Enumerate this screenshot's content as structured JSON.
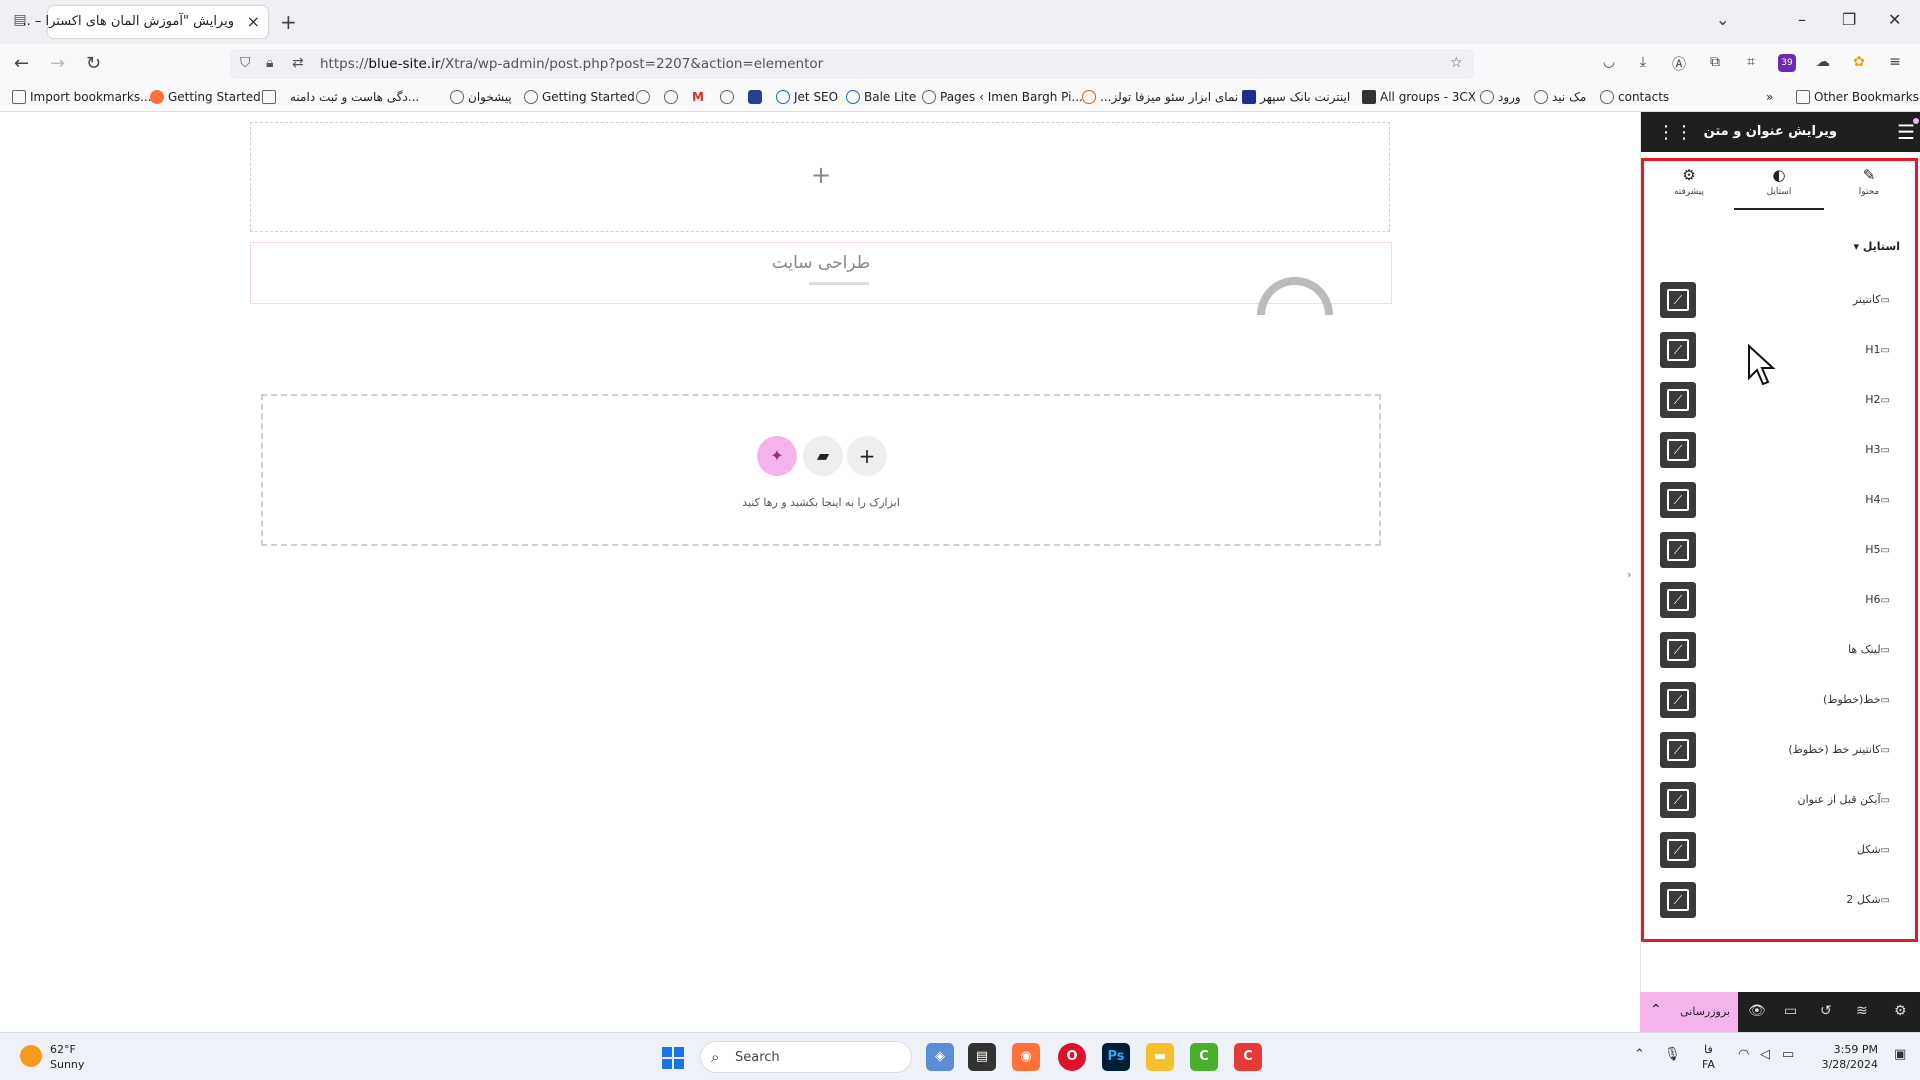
{
  "browser": {
    "tab_title": "ویرایش \"آموزش المان های اکسترا – ..",
    "url_prefix": "https://",
    "url_host": "blue-site.ir",
    "url_path": "/Xtra/wp-admin/post.php?post=2207&action=elementor",
    "notification_count": "39"
  },
  "bookmarks": [
    "Import bookmarks...",
    "Getting Started",
    "دگی هاست و ثبت دامنه...",
    "پیشخوان",
    "Getting Started",
    "Jet SEO",
    "Bale Lite",
    "Pages ‹ Imen Bargh Pi...",
    "...نمای ابزار سئو میزفا تولز",
    "اینترنت بانک سپهر",
    "All groups - 3CX",
    "ورود",
    "مک نید",
    "contacts",
    "Other Bookmarks"
  ],
  "canvas": {
    "heading": "طراحی سایت",
    "drop_hint": "ابزارک را به اینجا بکشید و رها کنید"
  },
  "panel": {
    "title": "ویرایش عنوان و متن",
    "tabs": [
      {
        "label": "محتوا",
        "icon": "pencil-icon"
      },
      {
        "label": "استایل",
        "icon": "contrast-icon"
      },
      {
        "label": "پیشرفته",
        "icon": "gear-icon"
      }
    ],
    "active_tab": "استایل",
    "section_title": "استایل",
    "rows": [
      "کانتینر",
      "H1",
      "H2",
      "H3",
      "H4",
      "H5",
      "H6",
      "لینک ها",
      "خط(خطوط)",
      "کانتینر خط (خطوط)",
      "آیکن قبل از عنوان",
      "شکل",
      "شکل 2"
    ],
    "update_label": "بروزرسانی"
  },
  "taskbar": {
    "temperature": "62°F",
    "weather": "Sunny",
    "search_label": "Search",
    "time": "3:59 PM",
    "date": "3/28/2024",
    "lang_top": "فا",
    "lang_bottom": "FA"
  },
  "colors": {
    "highlight": "#e81824",
    "accent_pink": "#f5b3ec",
    "panel_dark": "#1f1f1f"
  }
}
